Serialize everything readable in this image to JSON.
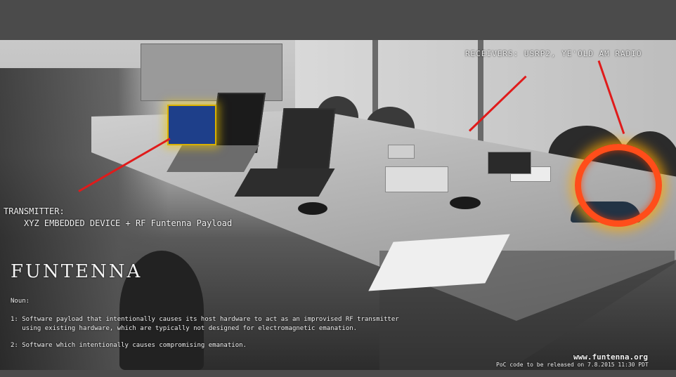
{
  "photo": {
    "receivers_label": "RECEIVERS: USRP2, YE'OLD AM RADIO",
    "transmitter_label": "TRANSMITTER:",
    "transmitter_desc": "XYZ EMBEDDED DEVICE + RF Funtenna Payload",
    "title": "FUNTENNA",
    "noun": "Noun:",
    "definition_1": "1: Software payload that intentionally causes its host hardware to act as an improvised RF transmitter\n   using existing hardware, which are typically not designed for electromagnetic emanation.",
    "definition_2": "2: Software which intentionally causes compromising emanation.",
    "website": "www.funtenna.org",
    "poc_note": "PoC code to be released on 7.8.2015 11:30 PDT"
  },
  "colors": {
    "arrow": "#e01b1b",
    "highlight_glow": "#ffb000",
    "text": "#f2f2f2"
  }
}
